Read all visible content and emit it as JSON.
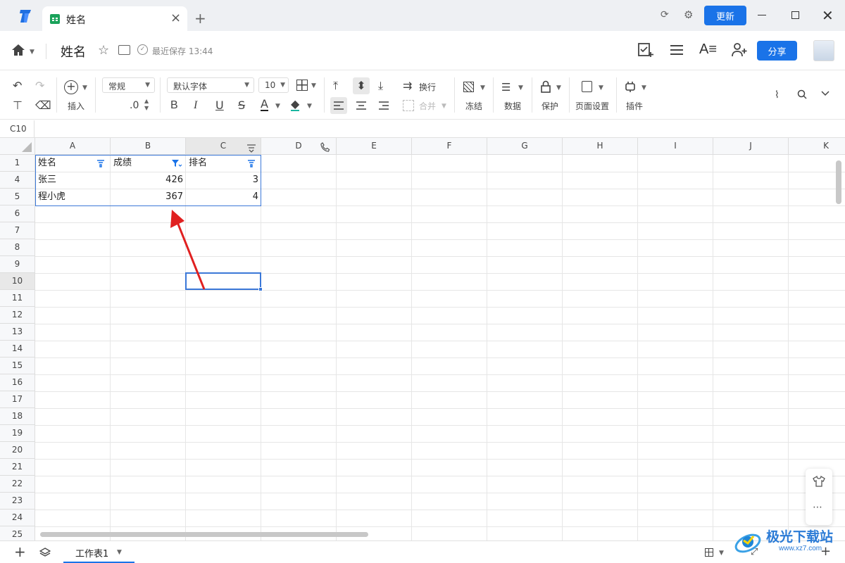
{
  "titlebar": {
    "tab_title": "姓名",
    "new_tab": "+",
    "update_label": "更新",
    "colors": {
      "accent": "#1a73e8",
      "sheet_icon": "#1aa25a"
    }
  },
  "docbar": {
    "title": "姓名",
    "save_status": "最近保存 13:44",
    "share_label": "分享"
  },
  "toolbar": {
    "insert_label": "插入",
    "number_format": "常规",
    "decimal_label": ".0",
    "font_name": "默认字体",
    "font_size": "10",
    "wrap_label": "换行",
    "merge_label": "合并",
    "freeze_label": "冻结",
    "data_label": "数据",
    "protect_label": "保护",
    "page_setup_label": "页面设置",
    "plugin_label": "插件"
  },
  "formula_bar": {
    "cell_ref": "C10"
  },
  "grid": {
    "columns": [
      "A",
      "B",
      "C",
      "D",
      "E",
      "F",
      "G",
      "H",
      "I",
      "J",
      "K"
    ],
    "rows": [
      "1",
      "4",
      "5",
      "6",
      "7",
      "8",
      "9",
      "10",
      "11",
      "12",
      "13",
      "14",
      "15",
      "16",
      "17",
      "18",
      "19",
      "20",
      "21",
      "22",
      "23",
      "24",
      "25"
    ],
    "header_row": [
      "姓名",
      "成绩",
      "排名"
    ],
    "data": [
      [
        "张三",
        "426",
        "3"
      ],
      [
        "程小虎",
        "367",
        "4"
      ]
    ]
  },
  "bottom": {
    "sheet_name": "工作表1"
  },
  "watermark": {
    "text": "极光下载站",
    "url_text": "www.xz7.com"
  }
}
